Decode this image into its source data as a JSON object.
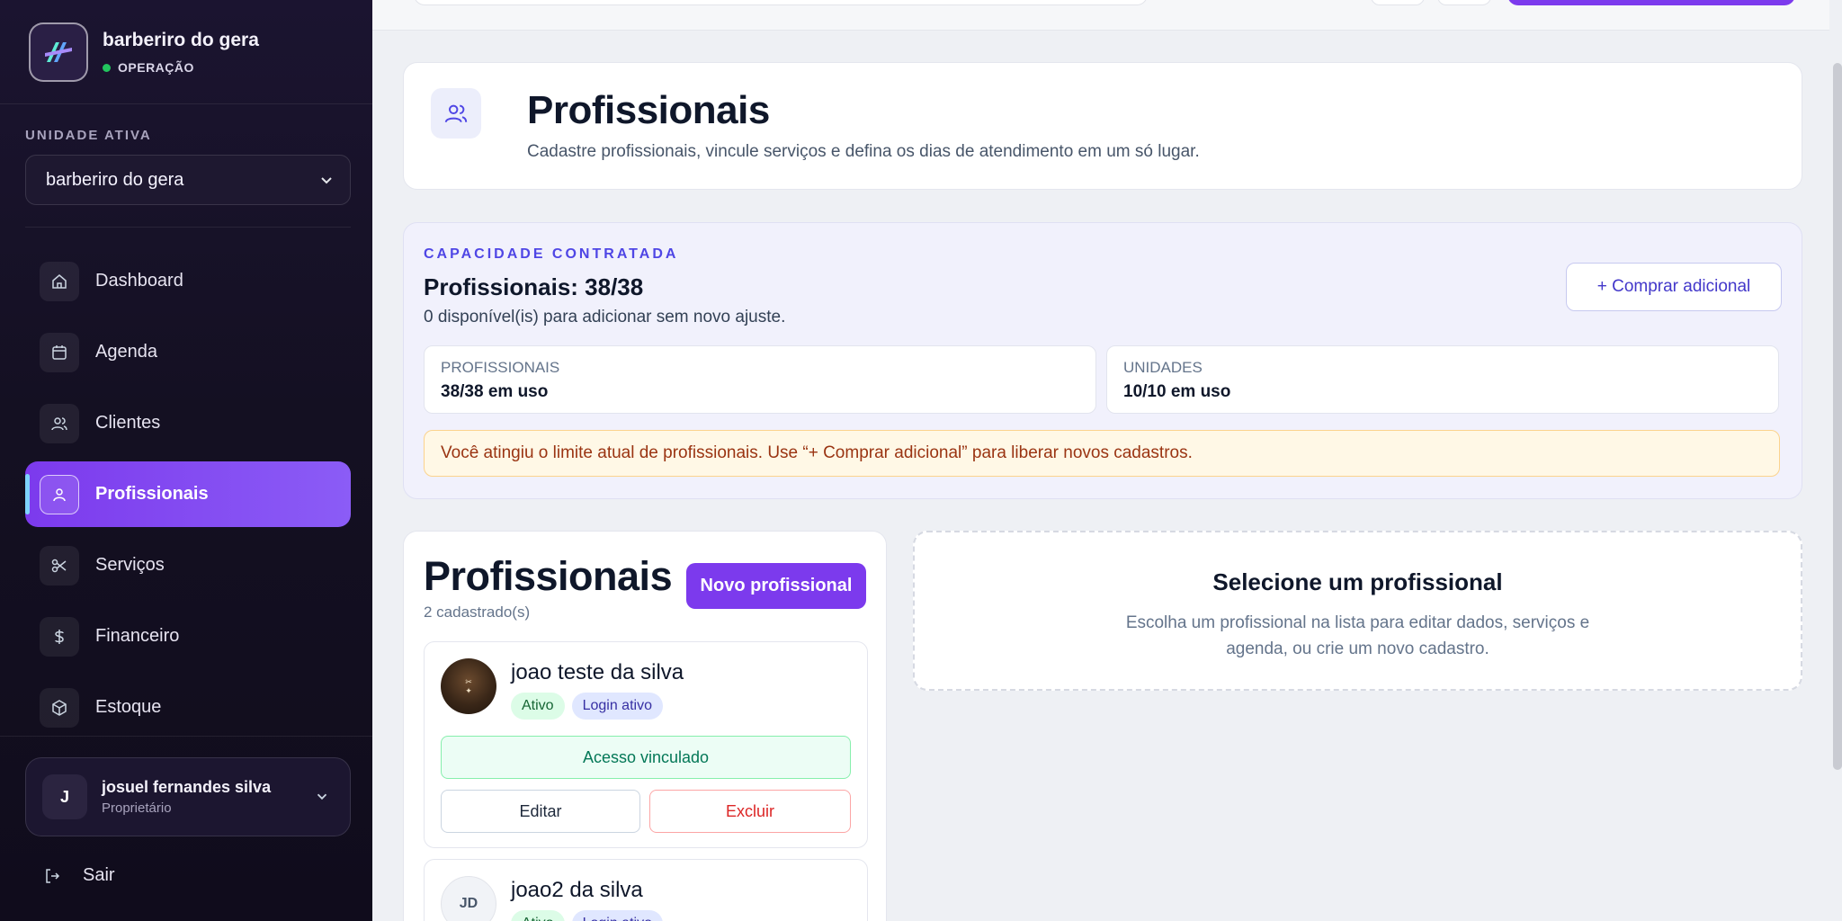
{
  "sidebar": {
    "brand_name": "barberiro do gera",
    "brand_status": "OPERAÇÃO",
    "unit_label": "UNIDADE ATIVA",
    "unit_selected": "barberiro do gera",
    "nav": [
      {
        "label": "Dashboard",
        "icon": "home-icon"
      },
      {
        "label": "Agenda",
        "icon": "calendar-icon"
      },
      {
        "label": "Clientes",
        "icon": "users-icon"
      },
      {
        "label": "Profissionais",
        "icon": "user-icon",
        "active": true
      },
      {
        "label": "Serviços",
        "icon": "scissors-icon"
      },
      {
        "label": "Financeiro",
        "icon": "dollar-icon"
      },
      {
        "label": "Estoque",
        "icon": "box-icon"
      }
    ],
    "user": {
      "initial": "J",
      "name": "josuel fernandes silva",
      "role": "Proprietário"
    },
    "logout_label": "Sair"
  },
  "header": {
    "title": "Profissionais",
    "subtitle": "Cadastre profissionais, vincule serviços e defina os dias de atendimento em um só lugar."
  },
  "capacity": {
    "label": "CAPACIDADE CONTRATADA",
    "title": "Profissionais: 38/38",
    "desc": "0 disponível(is) para adicionar sem novo ajuste.",
    "buy_label": "+ Comprar adicional",
    "stats": [
      {
        "key": "PROFISSIONAIS",
        "value": "38/38 em uso"
      },
      {
        "key": "UNIDADES",
        "value": "10/10 em uso"
      }
    ],
    "warning": "Você atingiu o limite atual de profissionais. Use “+ Comprar adicional” para liberar novos cadastros."
  },
  "list": {
    "title": "Profissionais",
    "count": "2 cadastrado(s)",
    "new_label": "Novo profissional",
    "items": [
      {
        "name": "joao teste da silva",
        "badges": [
          "Ativo",
          "Login ativo"
        ],
        "access": "Acesso vinculado",
        "edit": "Editar",
        "delete": "Excluir"
      },
      {
        "name": "joao2 da silva",
        "initials": "JD",
        "badges": [
          "Ativo",
          "Login ativo"
        ]
      }
    ]
  },
  "select_panel": {
    "title": "Selecione um profissional",
    "desc": "Escolha um profissional na lista para editar dados, serviços e agenda, ou crie um novo cadastro."
  },
  "colors": {
    "accent": "#7c3aed",
    "success": "#22c55e",
    "danger": "#dc2626",
    "indigo": "#4f46e5"
  }
}
